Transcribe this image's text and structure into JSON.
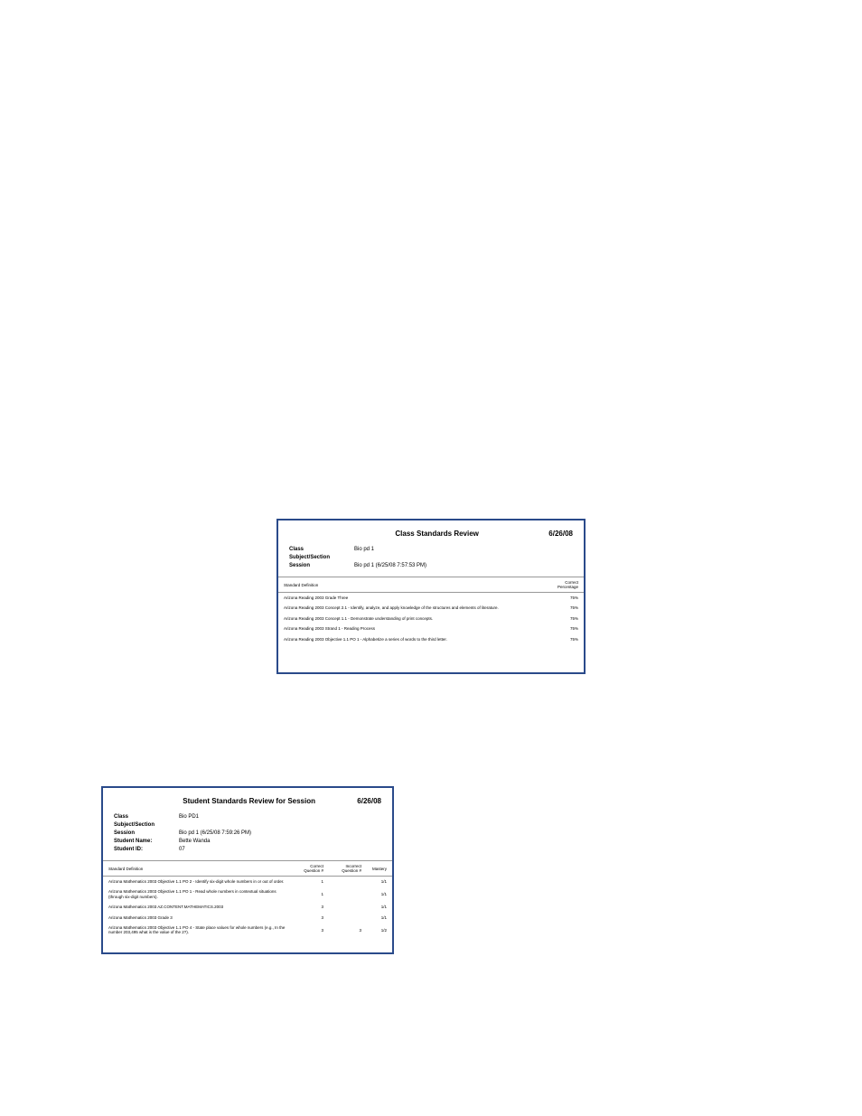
{
  "report1": {
    "title": "Class Standards Review",
    "date": "6/26/08",
    "meta": {
      "class_label": "Class",
      "class_value": "Bio pd 1",
      "subject_label": "Subject/Section",
      "subject_value": "",
      "session_label": "Session",
      "session_value": "Bio pd 1 (6/25/08 7:57:53 PM)"
    },
    "headers": {
      "definition": "Standard Definition",
      "percentage": "Correct Percentage"
    },
    "rows": [
      {
        "def": "Arizona Reading 2003 Grade Three",
        "pct": "75%"
      },
      {
        "def": "Arizona Reading 2003 Concept 2.1 - Identify, analyze, and apply knowledge of the structures and elements of literature.",
        "pct": "75%"
      },
      {
        "def": "Arizona Reading 2003 Concept 1.1 - Demonstrate understanding of print concepts.",
        "pct": "75%"
      },
      {
        "def": "Arizona Reading 2003 Strand 1 - Reading Process",
        "pct": "75%"
      },
      {
        "def": "Arizona Reading 2003 Objective 1.1 PO 1 - Alphabetize a series of words to the third letter.",
        "pct": "75%"
      }
    ]
  },
  "report2": {
    "title": "Student Standards Review for Session",
    "date": "6/26/08",
    "meta": {
      "class_label": "Class",
      "class_value": "Bio PD1",
      "subject_label": "Subject/Section",
      "subject_value": "",
      "session_label": "Session",
      "session_value": "Bio pd 1 (6/25/08 7:59:26 PM)",
      "student_name_label": "Student Name:",
      "student_name_value": "Bette Wanda",
      "student_id_label": "Student ID:",
      "student_id_value": "07"
    },
    "headers": {
      "definition": "Standard Definition",
      "correct": "Correct Question #",
      "incorrect": "Incorrect Question #",
      "mastery": "Mastery"
    },
    "rows": [
      {
        "def": "Arizona Mathematics 2003 Objective 1.1 PO 2 - Identify six-digit whole numbers in or out of order.",
        "correct": "1",
        "incorrect": "",
        "mastery": "1/1"
      },
      {
        "def": "Arizona Mathematics 2003 Objective 1.1 PO 1 - Read whole numbers in contextual situations (through six-digit numbers).",
        "correct": "1",
        "incorrect": "",
        "mastery": "1/1"
      },
      {
        "def": "Arizona Mathematics 2003 AZ.CONTENT.MATHEMATICS.2003",
        "correct": "3",
        "incorrect": "",
        "mastery": "1/1"
      },
      {
        "def": "Arizona Mathematics 2003 Grade 3",
        "correct": "3",
        "incorrect": "",
        "mastery": "1/1"
      },
      {
        "def": "Arizona Mathematics 2003 Objective 1.1 PO 4 - State place values for whole numbers (e.g., In the number 203,495 what is the value of the 2?).",
        "correct": "3",
        "incorrect": "3",
        "mastery": "1/2"
      }
    ]
  }
}
